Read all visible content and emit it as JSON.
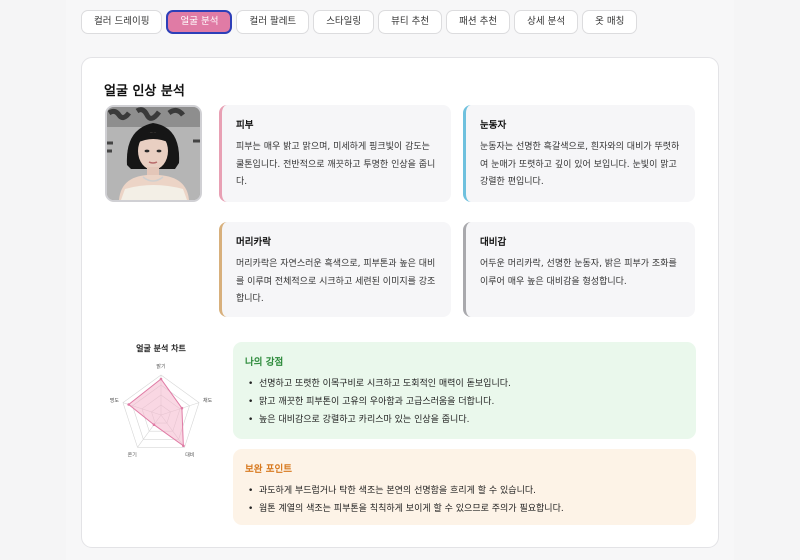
{
  "tabs": [
    {
      "label": "컬러 드레이핑",
      "active": false
    },
    {
      "label": "얼굴 분석",
      "active": true
    },
    {
      "label": "컬러 팔레트",
      "active": false
    },
    {
      "label": "스타일링",
      "active": false
    },
    {
      "label": "뷰티 추천",
      "active": false
    },
    {
      "label": "패션 추천",
      "active": false
    },
    {
      "label": "상세 분석",
      "active": false
    },
    {
      "label": "옷 매칭",
      "active": false
    }
  ],
  "card_title": "얼굴 인상 분석",
  "features": {
    "skin": {
      "title": "피부",
      "desc": "피부는 매우 밝고 맑으며, 미세하게 핑크빛이 감도는 쿨톤입니다. 전반적으로 깨끗하고 투명한 인상을 줍니다."
    },
    "eyes": {
      "title": "눈동자",
      "desc": "눈동자는 선명한 흑갈색으로, 흰자와의 대비가 뚜렷하여 눈매가 또렷하고 깊이 있어 보입니다. 눈빛이 맑고 강렬한 편입니다."
    },
    "hair": {
      "title": "머리카락",
      "desc": "머리카락은 자연스러운 흑색으로, 피부톤과 높은 대비를 이루며 전체적으로 시크하고 세련된 이미지를 강조합니다."
    },
    "contrast": {
      "title": "대비감",
      "desc": "어두운 머리카락, 선명한 눈동자, 밝은 피부가 조화를 이루어 매우 높은 대비감을 형성합니다."
    }
  },
  "chart_data": {
    "type": "radar",
    "title": "얼굴 분석 차트",
    "categories": [
      "밝기",
      "채도",
      "대비",
      "온기",
      "명도"
    ],
    "values": [
      0.9,
      0.55,
      0.95,
      0.3,
      0.85
    ],
    "range": [
      0,
      1
    ],
    "fill": "#f4b6cc",
    "stroke": "#e07ba5"
  },
  "strengths": {
    "title": "나의 강점",
    "items": [
      "선명하고 또렷한 이목구비로 시크하고 도회적인 매력이 돋보입니다.",
      "맑고 깨끗한 피부톤이 고유의 우아함과 고급스러움을 더합니다.",
      "높은 대비감으로 강렬하고 카리스마 있는 인상을 줍니다."
    ]
  },
  "improvements": {
    "title": "보완 포인트",
    "items": [
      "과도하게 부드럽거나 탁한 색조는 본연의 선명함을 흐리게 할 수 있습니다.",
      "웜톤 계열의 색조는 피부톤을 칙칙하게 보이게 할 수 있으므로 주의가 필요합니다."
    ]
  }
}
